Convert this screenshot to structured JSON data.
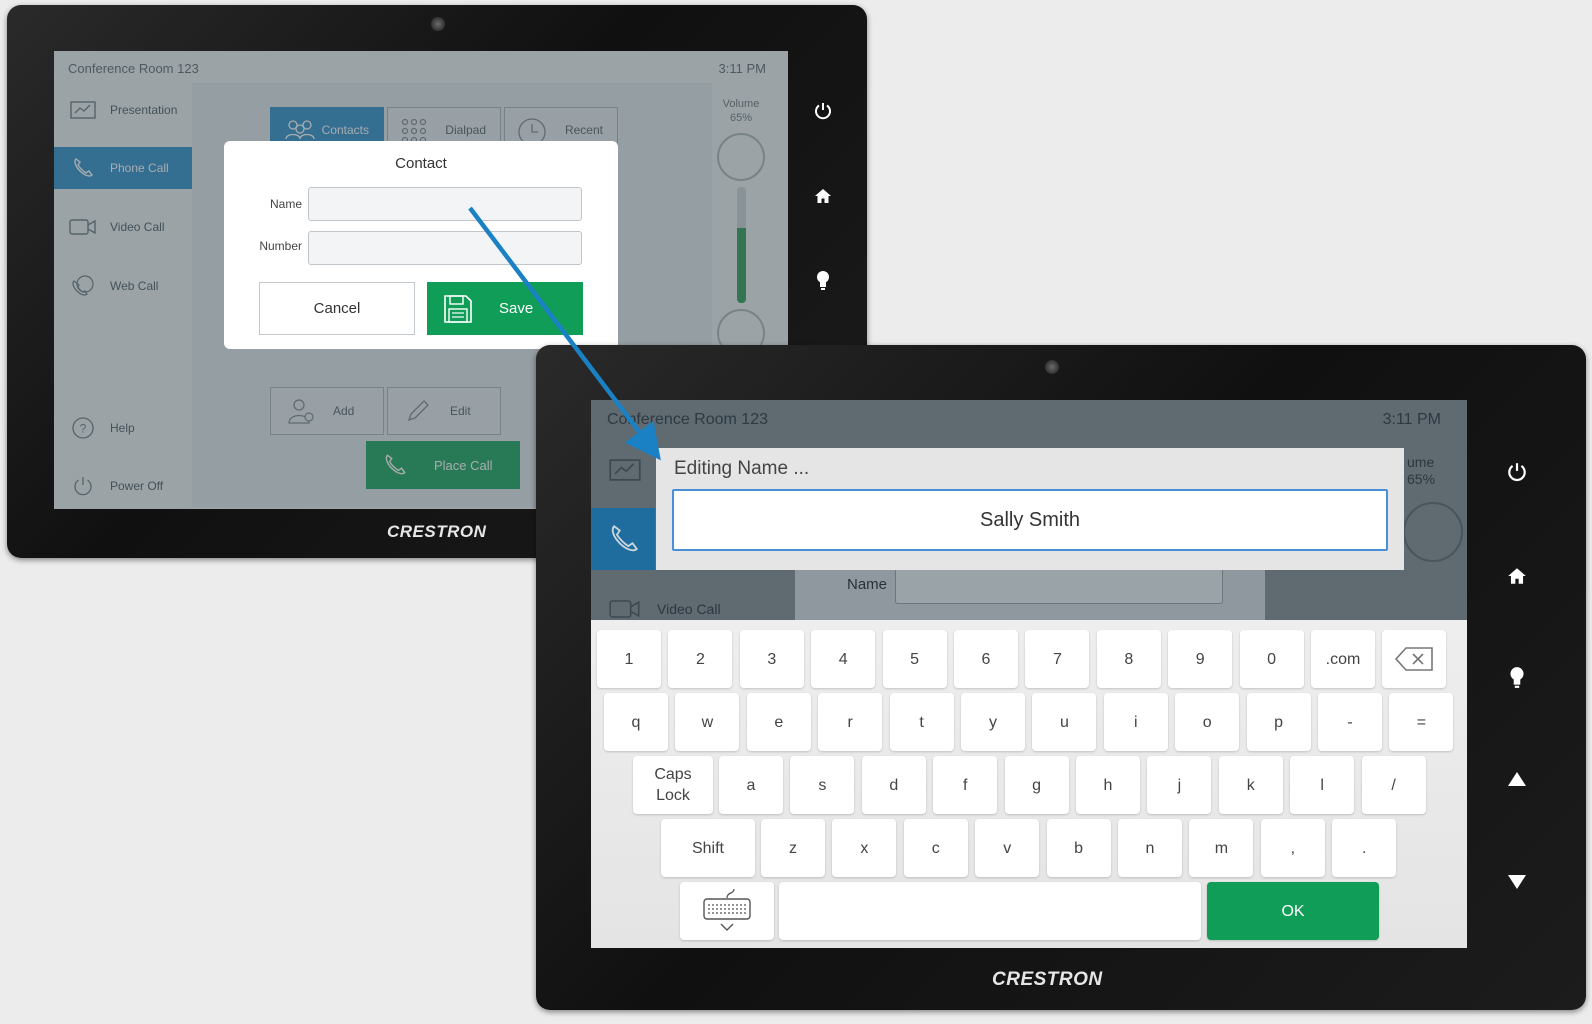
{
  "device_back": {
    "brand": "CRESTRON",
    "room_title": "Conference Room 123",
    "time": "3:11 PM",
    "nav": [
      {
        "label": "Presentation",
        "icon": "presentation-icon"
      },
      {
        "label": "Phone Call",
        "icon": "phone-icon",
        "active": true
      },
      {
        "label": "Video Call",
        "icon": "video-camera-icon"
      },
      {
        "label": "Web Call",
        "icon": "web-call-icon"
      },
      {
        "label": "Help",
        "icon": "help-icon"
      },
      {
        "label": "Power Off",
        "icon": "power-icon"
      }
    ],
    "tabs": [
      {
        "label": "Contacts",
        "icon": "contacts-icon",
        "active": true
      },
      {
        "label": "Dialpad",
        "icon": "dialpad-icon"
      },
      {
        "label": "Recent",
        "icon": "clock-icon"
      }
    ],
    "volume": {
      "label": "Volume",
      "value": "65%",
      "level": 0.65
    },
    "actions": [
      {
        "label": "Add",
        "icon": "add-contact-icon"
      },
      {
        "label": "Edit",
        "icon": "pencil-icon"
      }
    ],
    "place_call": "Place Call",
    "dialog": {
      "title": "Contact",
      "name_label": "Name",
      "number_label": "Number",
      "cancel": "Cancel",
      "save": "Save"
    },
    "hardware_buttons": [
      "power-icon",
      "home-icon",
      "light-bulb-icon"
    ]
  },
  "device_front": {
    "brand": "CRESTRON",
    "room_title": "Conference Room 123",
    "time": "3:11 PM",
    "background": {
      "video_call": "Video Call",
      "name_label": "Name",
      "volume_partial": "ume",
      "volume_partial_value": "65%"
    },
    "editor": {
      "title": "Editing Name ...",
      "value": "Sally Smith"
    },
    "keyboard": {
      "row1": [
        "1",
        "2",
        "3",
        "4",
        "5",
        "6",
        "7",
        "8",
        "9",
        "0",
        ".com"
      ],
      "row2": [
        "q",
        "w",
        "e",
        "r",
        "t",
        "y",
        "u",
        "i",
        "o",
        "p",
        "-",
        "="
      ],
      "caps": "Caps Lock",
      "row3": [
        "a",
        "s",
        "d",
        "f",
        "g",
        "h",
        "j",
        "k",
        "l",
        "/"
      ],
      "shift": "Shift",
      "row4": [
        "z",
        "x",
        "c",
        "v",
        "b",
        "n",
        "m",
        ",",
        "."
      ],
      "ok": "OK"
    },
    "hardware_buttons": [
      "power-icon",
      "home-icon",
      "light-bulb-icon",
      "up-arrow-icon",
      "down-arrow-icon"
    ]
  },
  "colors": {
    "accent_blue": "#2f8ecb",
    "save_green": "#0f9d58",
    "arrow_blue": "#1a82c4"
  }
}
